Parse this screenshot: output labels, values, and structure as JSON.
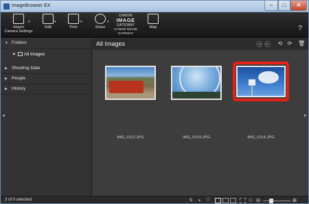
{
  "window": {
    "title": "ImageBrowser EX"
  },
  "toolbar": {
    "import_label_line1": "Import",
    "import_label_line2": "Camera Settings",
    "edit_label": "Edit",
    "print_label": "Print",
    "share_label": "Share",
    "gateway_cap": "CANON",
    "gateway_big": "IMAGE",
    "gateway_cap2": "GATEWAY",
    "gateway_line1": "CANON IMAGE",
    "gateway_line2": "GATEWAY",
    "map_label": "Map",
    "help": "?"
  },
  "sidebar": {
    "folders": "Folders",
    "all_images": "All Images",
    "shooting_date": "Shooting Date",
    "people": "People",
    "history": "History"
  },
  "main": {
    "title": "All Images",
    "thumbnails": [
      {
        "filename": "IMG_0112.JPG",
        "selected": false
      },
      {
        "filename": "IMG_0103.JPG",
        "selected": false
      },
      {
        "filename": "IMG_0114.JPG",
        "selected": true
      }
    ],
    "highlight_color": "#e8201a"
  },
  "status": {
    "selection_text": "3 of 0 selected",
    "zoom_x1": "x1"
  },
  "icons": {
    "close": "close-icon",
    "maximize": "maximize-icon",
    "minimize": "minimize-icon",
    "trash": "trash-icon",
    "rotate_left": "rotate-left-icon",
    "rotate_right": "rotate-right-icon",
    "gear": "gear-icon",
    "help": "help-icon"
  }
}
